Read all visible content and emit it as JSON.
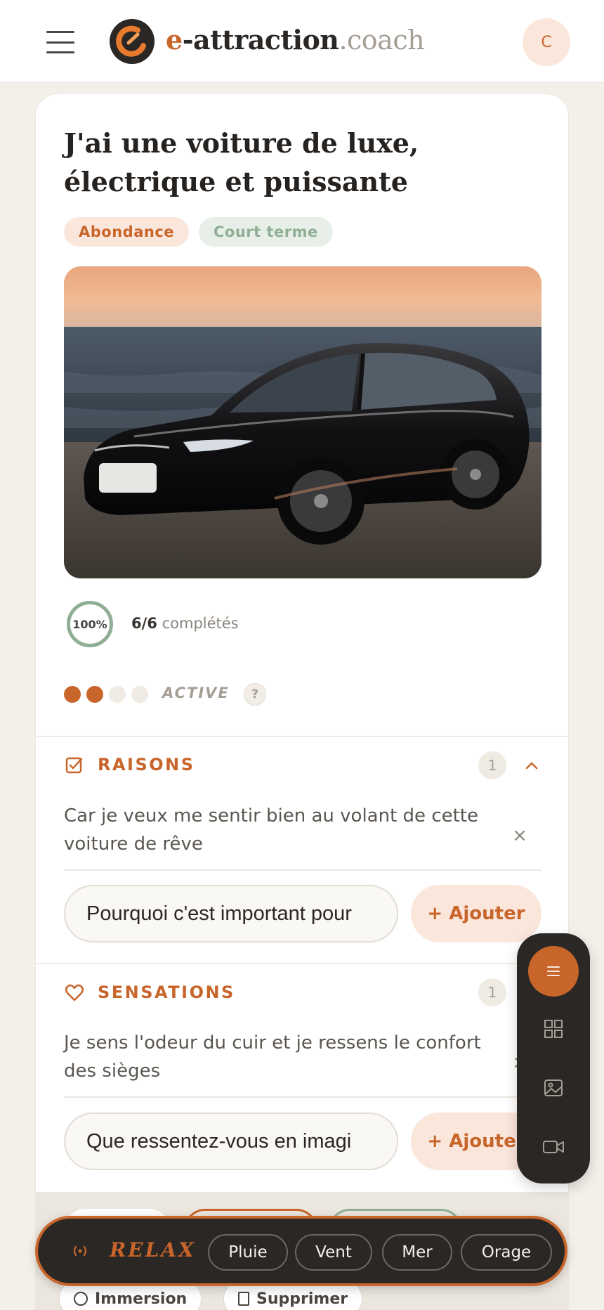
{
  "header": {
    "brand_e": "e",
    "brand_main": "-attraction",
    "brand_suffix": ".coach",
    "avatar_initial": "C"
  },
  "goal": {
    "title": "J'ai une voiture de luxe, électrique et puissante",
    "tags": [
      "Abondance",
      "Court terme"
    ],
    "progress_percent_label": "100%",
    "progress_percent": 100,
    "progress_count": "6/6",
    "progress_suffix": "complétés",
    "status_dots_filled": 2,
    "status_dots_total": 4,
    "status_label": "ACTIVE",
    "help_label": "?"
  },
  "sections": {
    "raisons": {
      "title": "RAISONS",
      "count": "1",
      "entries": [
        "Car je veux me sentir bien au volant de cette voiture de rêve"
      ],
      "input_placeholder": "Pourquoi c'est important pour",
      "add_label": "+ Ajouter"
    },
    "sensations": {
      "title": "SENSATIONS",
      "count": "1",
      "entries": [
        "Je sens l'odeur du cuir et je ressens le confort des sièges"
      ],
      "input_placeholder": "Que ressentez-vous en imagi",
      "add_label": "+ Ajouter"
    }
  },
  "actions": {
    "immersion_label": "Immersion",
    "delete_label": "Supprimer"
  },
  "relax_bar": {
    "label": "RELAX",
    "sounds": [
      "Pluie",
      "Vent",
      "Mer",
      "Orage"
    ]
  },
  "dock": {
    "items": [
      "list-icon",
      "grid-icon",
      "image-icon",
      "video-icon"
    ]
  },
  "colors": {
    "accent": "#c8652a",
    "accent_soft": "#fbe6dc",
    "sage": "#8fae95",
    "dark": "#2a2725",
    "background": "#f3f0ea"
  }
}
